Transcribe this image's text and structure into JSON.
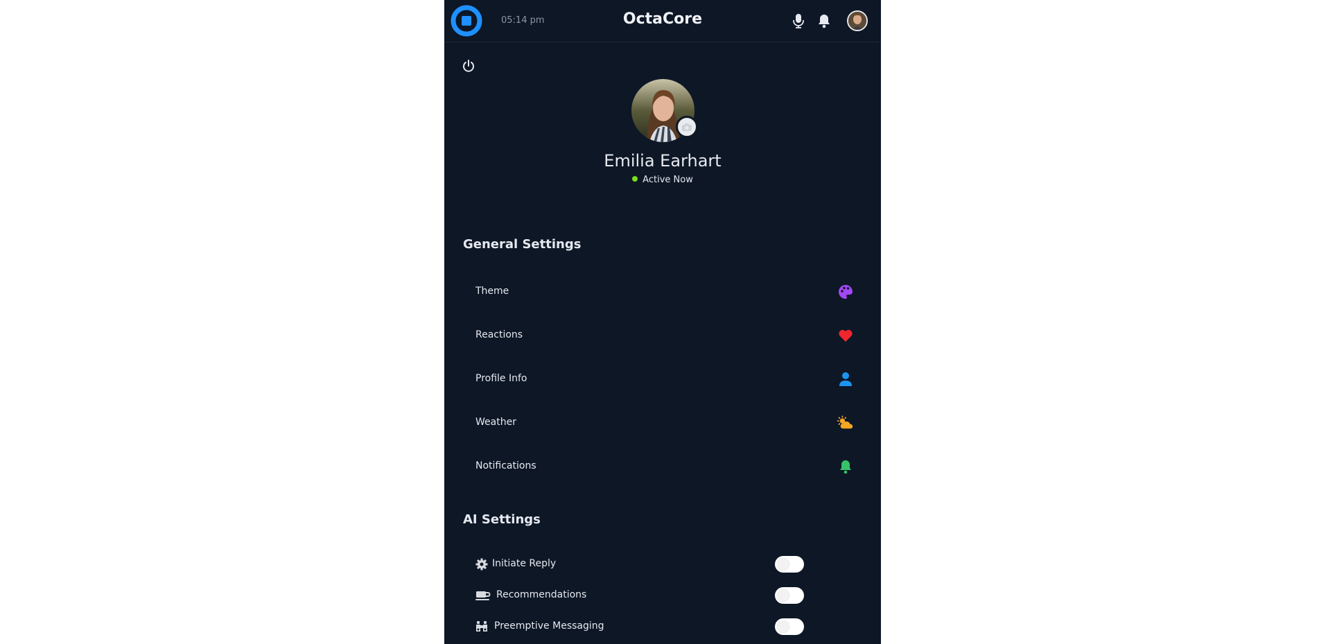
{
  "header": {
    "time": "05:14 pm",
    "app_title": "OctaCore",
    "logo_color": "#1e90ff"
  },
  "profile": {
    "name": "Emilia Earhart",
    "status": "Active Now",
    "status_color": "#7ddb1f"
  },
  "general_settings": {
    "title": "General Settings",
    "items": [
      {
        "label": "Theme",
        "icon": "palette-icon",
        "color": "#a347f5"
      },
      {
        "label": "Reactions",
        "icon": "heart-icon",
        "color": "#f0262e"
      },
      {
        "label": "Profile Info",
        "icon": "user-icon",
        "color": "#1c95f0"
      },
      {
        "label": "Weather",
        "icon": "sun-cloud-icon",
        "color": "#f5a623"
      },
      {
        "label": "Notifications",
        "icon": "bell-icon",
        "color": "#37c26a"
      }
    ]
  },
  "ai_settings": {
    "title": "AI Settings",
    "items": [
      {
        "label": "Initiate Reply",
        "icon": "gear-icon",
        "enabled": false
      },
      {
        "label": "Recommendations",
        "icon": "coffee-icon",
        "enabled": false
      },
      {
        "label": "Preemptive Messaging",
        "icon": "binoculars-icon",
        "enabled": false
      }
    ]
  }
}
